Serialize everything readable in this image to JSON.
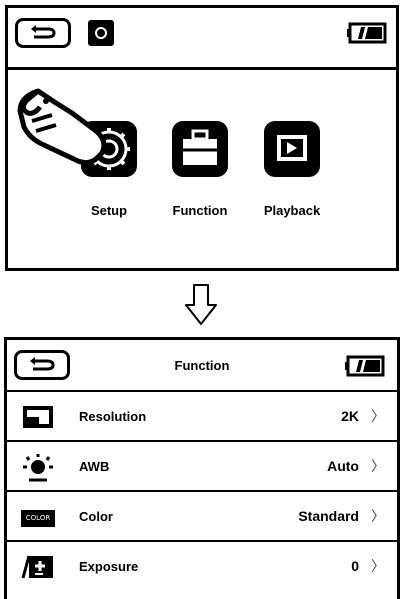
{
  "top_screen": {
    "header": {
      "back_icon": "back-arrow-icon",
      "mode_icon": "camera-icon",
      "battery_icon": "battery-icon"
    },
    "menu": [
      {
        "label": "Setup",
        "icon": "gear-icon",
        "selected": true
      },
      {
        "label": "Function",
        "icon": "briefcase-icon",
        "selected": false
      },
      {
        "label": "Playback",
        "icon": "playback-icon",
        "selected": false
      }
    ],
    "pointer_icon": "hand-pointer-icon"
  },
  "transition_icon": "down-arrow-icon",
  "bottom_screen": {
    "header": {
      "title": "Function",
      "back_icon": "back-arrow-icon",
      "battery_icon": "battery-icon"
    },
    "rows": [
      {
        "label": "Resolution",
        "value": "2K",
        "icon": "resolution-icon"
      },
      {
        "label": "AWB",
        "value": "Auto",
        "icon": "white-balance-icon"
      },
      {
        "label": "Color",
        "value": "Standard",
        "icon": "color-icon",
        "badge_text": "COLOR"
      },
      {
        "label": "Exposure",
        "value": "0",
        "icon": "exposure-icon"
      }
    ],
    "chevron": "〉"
  }
}
